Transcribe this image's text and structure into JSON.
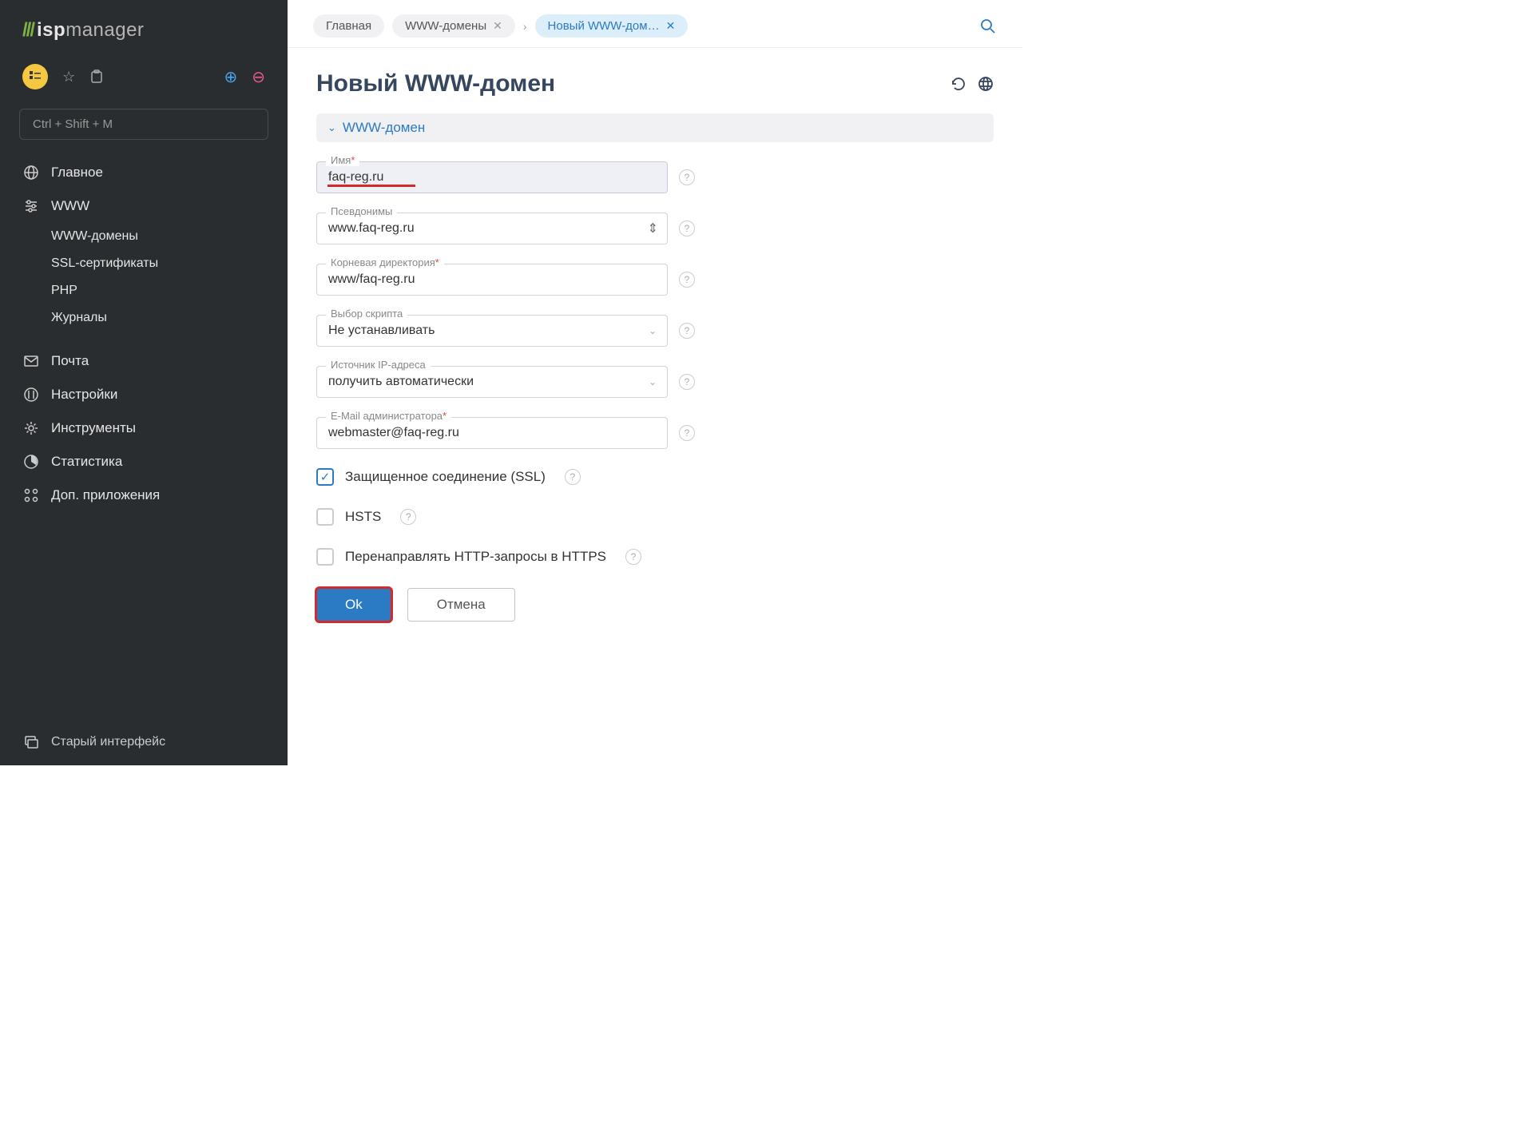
{
  "logo": {
    "brand": "isp",
    "suffix": "manager"
  },
  "search_placeholder": "Ctrl + Shift + M",
  "sidebar": {
    "items": [
      {
        "label": "Главное"
      },
      {
        "label": "WWW"
      },
      {
        "label": "Почта"
      },
      {
        "label": "Настройки"
      },
      {
        "label": "Инструменты"
      },
      {
        "label": "Статистика"
      },
      {
        "label": "Доп. приложения"
      }
    ],
    "sub": [
      {
        "label": "WWW-домены"
      },
      {
        "label": "SSL-сертификаты"
      },
      {
        "label": "PHP"
      },
      {
        "label": "Журналы"
      }
    ],
    "footer": "Старый интерфейс"
  },
  "breadcrumbs": [
    {
      "label": "Главная"
    },
    {
      "label": "WWW-домены"
    },
    {
      "label": "Новый WWW-дом…"
    }
  ],
  "page_title": "Новый WWW-домен",
  "section_label": "WWW-домен",
  "fields": {
    "name": {
      "label": "Имя",
      "value": "faq-reg.ru"
    },
    "aliases": {
      "label": "Псевдонимы",
      "value": "www.faq-reg.ru"
    },
    "root": {
      "label": "Корневая директория",
      "value": "www/faq-reg.ru"
    },
    "script": {
      "label": "Выбор скрипта",
      "value": "Не устанавливать"
    },
    "ip": {
      "label": "Источник IP-адреса",
      "value": "получить автоматически"
    },
    "email": {
      "label": "E-Mail администратора",
      "value": "webmaster@faq-reg.ru"
    }
  },
  "checks": {
    "ssl": "Защищенное соединение (SSL)",
    "hsts": "HSTS",
    "redirect": "Перенаправлять HTTP-запросы в HTTPS"
  },
  "buttons": {
    "ok": "Ok",
    "cancel": "Отмена"
  }
}
